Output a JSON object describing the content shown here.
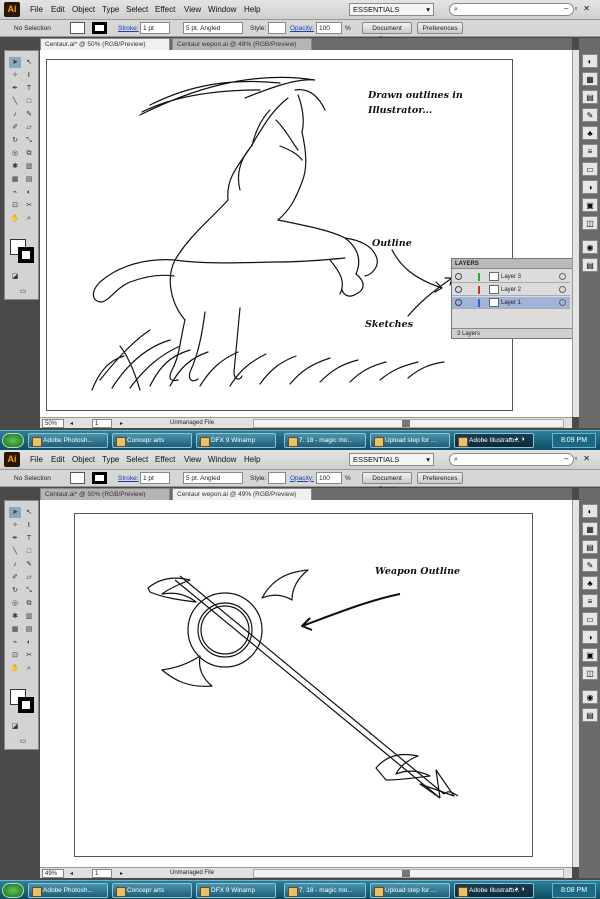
{
  "app": {
    "logo": "Ai"
  },
  "menu": [
    "File",
    "Edit",
    "Object",
    "Type",
    "Select",
    "Effect",
    "View",
    "Window",
    "Help"
  ],
  "workspace": "ESSENTIALS",
  "search_placeholder": "",
  "control": {
    "selection": "No Selection",
    "stroke_label": "Stroke:",
    "stroke_weight": "1 pt",
    "brush": "5 pt. Angled",
    "style_label": "Style:",
    "opacity_label": "Opacity:",
    "opacity_value": "100",
    "percent": "%",
    "doc_setup": "Document Setup",
    "preferences": "Preferences"
  },
  "tabs": [
    "Centaur.ai* @ 50% (RGB/Preview)",
    "Centaur wepon.ai @ 49% (RGB/Preview)"
  ],
  "shot1": {
    "zoom": "50%",
    "page": "1",
    "status": "Unmanaged File",
    "annotations": {
      "title": "Drawn outlines in Illustrator...",
      "outline": "Outline",
      "sketches": "Sketches"
    },
    "layers_panel": {
      "title": "LAYERS",
      "layers": [
        {
          "name": "Layer 3",
          "color": "#2ea82e"
        },
        {
          "name": "Layer 2",
          "color": "#d12e2e"
        },
        {
          "name": "Layer 1",
          "color": "#3a5fd0"
        }
      ],
      "footer": "3 Layers"
    },
    "taskbar": {
      "items": [
        "Adobe Photosh...",
        "Concepr arts",
        "DFX 9 Winamp",
        "7. 18 - magic mo...",
        "Upload step for ...",
        "Adobe Illustrato..."
      ],
      "clock": "8:09 PM"
    }
  },
  "shot2": {
    "zoom": "49%",
    "page": "1",
    "status": "Unmanaged File",
    "annotations": {
      "weapon": "Weapon Outline"
    },
    "taskbar": {
      "items": [
        "Adobe Photosh...",
        "Concepr arts",
        "DFX 9 Winamp",
        "7. 18 - magic mo...",
        "Upload step for ...",
        "Adobe Illustrato..."
      ],
      "clock": "8:08 PM"
    }
  },
  "colors": {
    "taskbar": "#1f6580",
    "accent_ai": "#f5a300"
  },
  "icons": [
    "ai-logo",
    "selection-tool-icon",
    "direct-selection-tool-icon",
    "magic-wand-icon",
    "lasso-icon",
    "pen-tool-icon",
    "type-tool-icon",
    "line-tool-icon",
    "rectangle-tool-icon",
    "paintbrush-icon",
    "pencil-icon",
    "blob-brush-icon",
    "eraser-icon",
    "rotate-tool-icon",
    "scale-tool-icon",
    "warp-tool-icon",
    "free-transform-icon",
    "symbol-sprayer-icon",
    "graph-tool-icon",
    "mesh-tool-icon",
    "gradient-tool-icon",
    "eyedropper-icon",
    "blend-tool-icon",
    "slice-tool-icon",
    "scissors-icon",
    "hand-tool-icon",
    "zoom-tool-icon",
    "swap-fill-stroke-icon",
    "screen-mode-icon",
    "search-icon",
    "start-icon"
  ]
}
